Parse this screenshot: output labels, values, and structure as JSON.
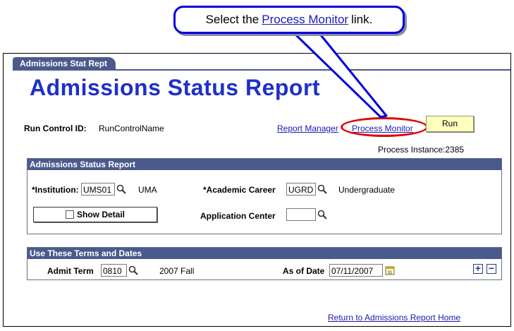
{
  "callout": {
    "prefix": "Select the",
    "link_text": "Process Monitor",
    "suffix": "link."
  },
  "tab": {
    "label": "Admissions Stat Rept"
  },
  "page": {
    "title": "Admissions Status Report"
  },
  "run_control": {
    "label": "Run Control ID:",
    "value": "RunControlName"
  },
  "links": {
    "report_manager": "Report Manager",
    "process_monitor": "Process Monitor",
    "return_home": "Return to Admissions Report Home"
  },
  "run_button": {
    "label": "Run"
  },
  "process_instance": {
    "text": "Process Instance:2385"
  },
  "section_report": {
    "header": "Admissions Status Report",
    "institution": {
      "label": "*Institution:",
      "value": "UMS01",
      "description": "UMA"
    },
    "career": {
      "label": "*Academic Career",
      "value": "UGRD",
      "description": "Undergraduate"
    },
    "show_detail": {
      "label": "Show Detail",
      "checked": false
    },
    "app_center": {
      "label": "Application Center",
      "value": ""
    }
  },
  "section_terms": {
    "header": "Use These Terms and Dates",
    "admit_term": {
      "label": "Admit Term",
      "value": "0810",
      "description": "2007 Fall"
    },
    "as_of_date": {
      "label": "As of Date",
      "value": "07/11/2007"
    },
    "add_label": "+",
    "remove_label": "−"
  },
  "colors": {
    "header_bg": "#4a5a8c",
    "title": "#1f2fc8",
    "link": "#1a1ab0",
    "run_bg": "#ffffc0",
    "highlight": "#e00000",
    "callout_border": "#0000dd"
  }
}
